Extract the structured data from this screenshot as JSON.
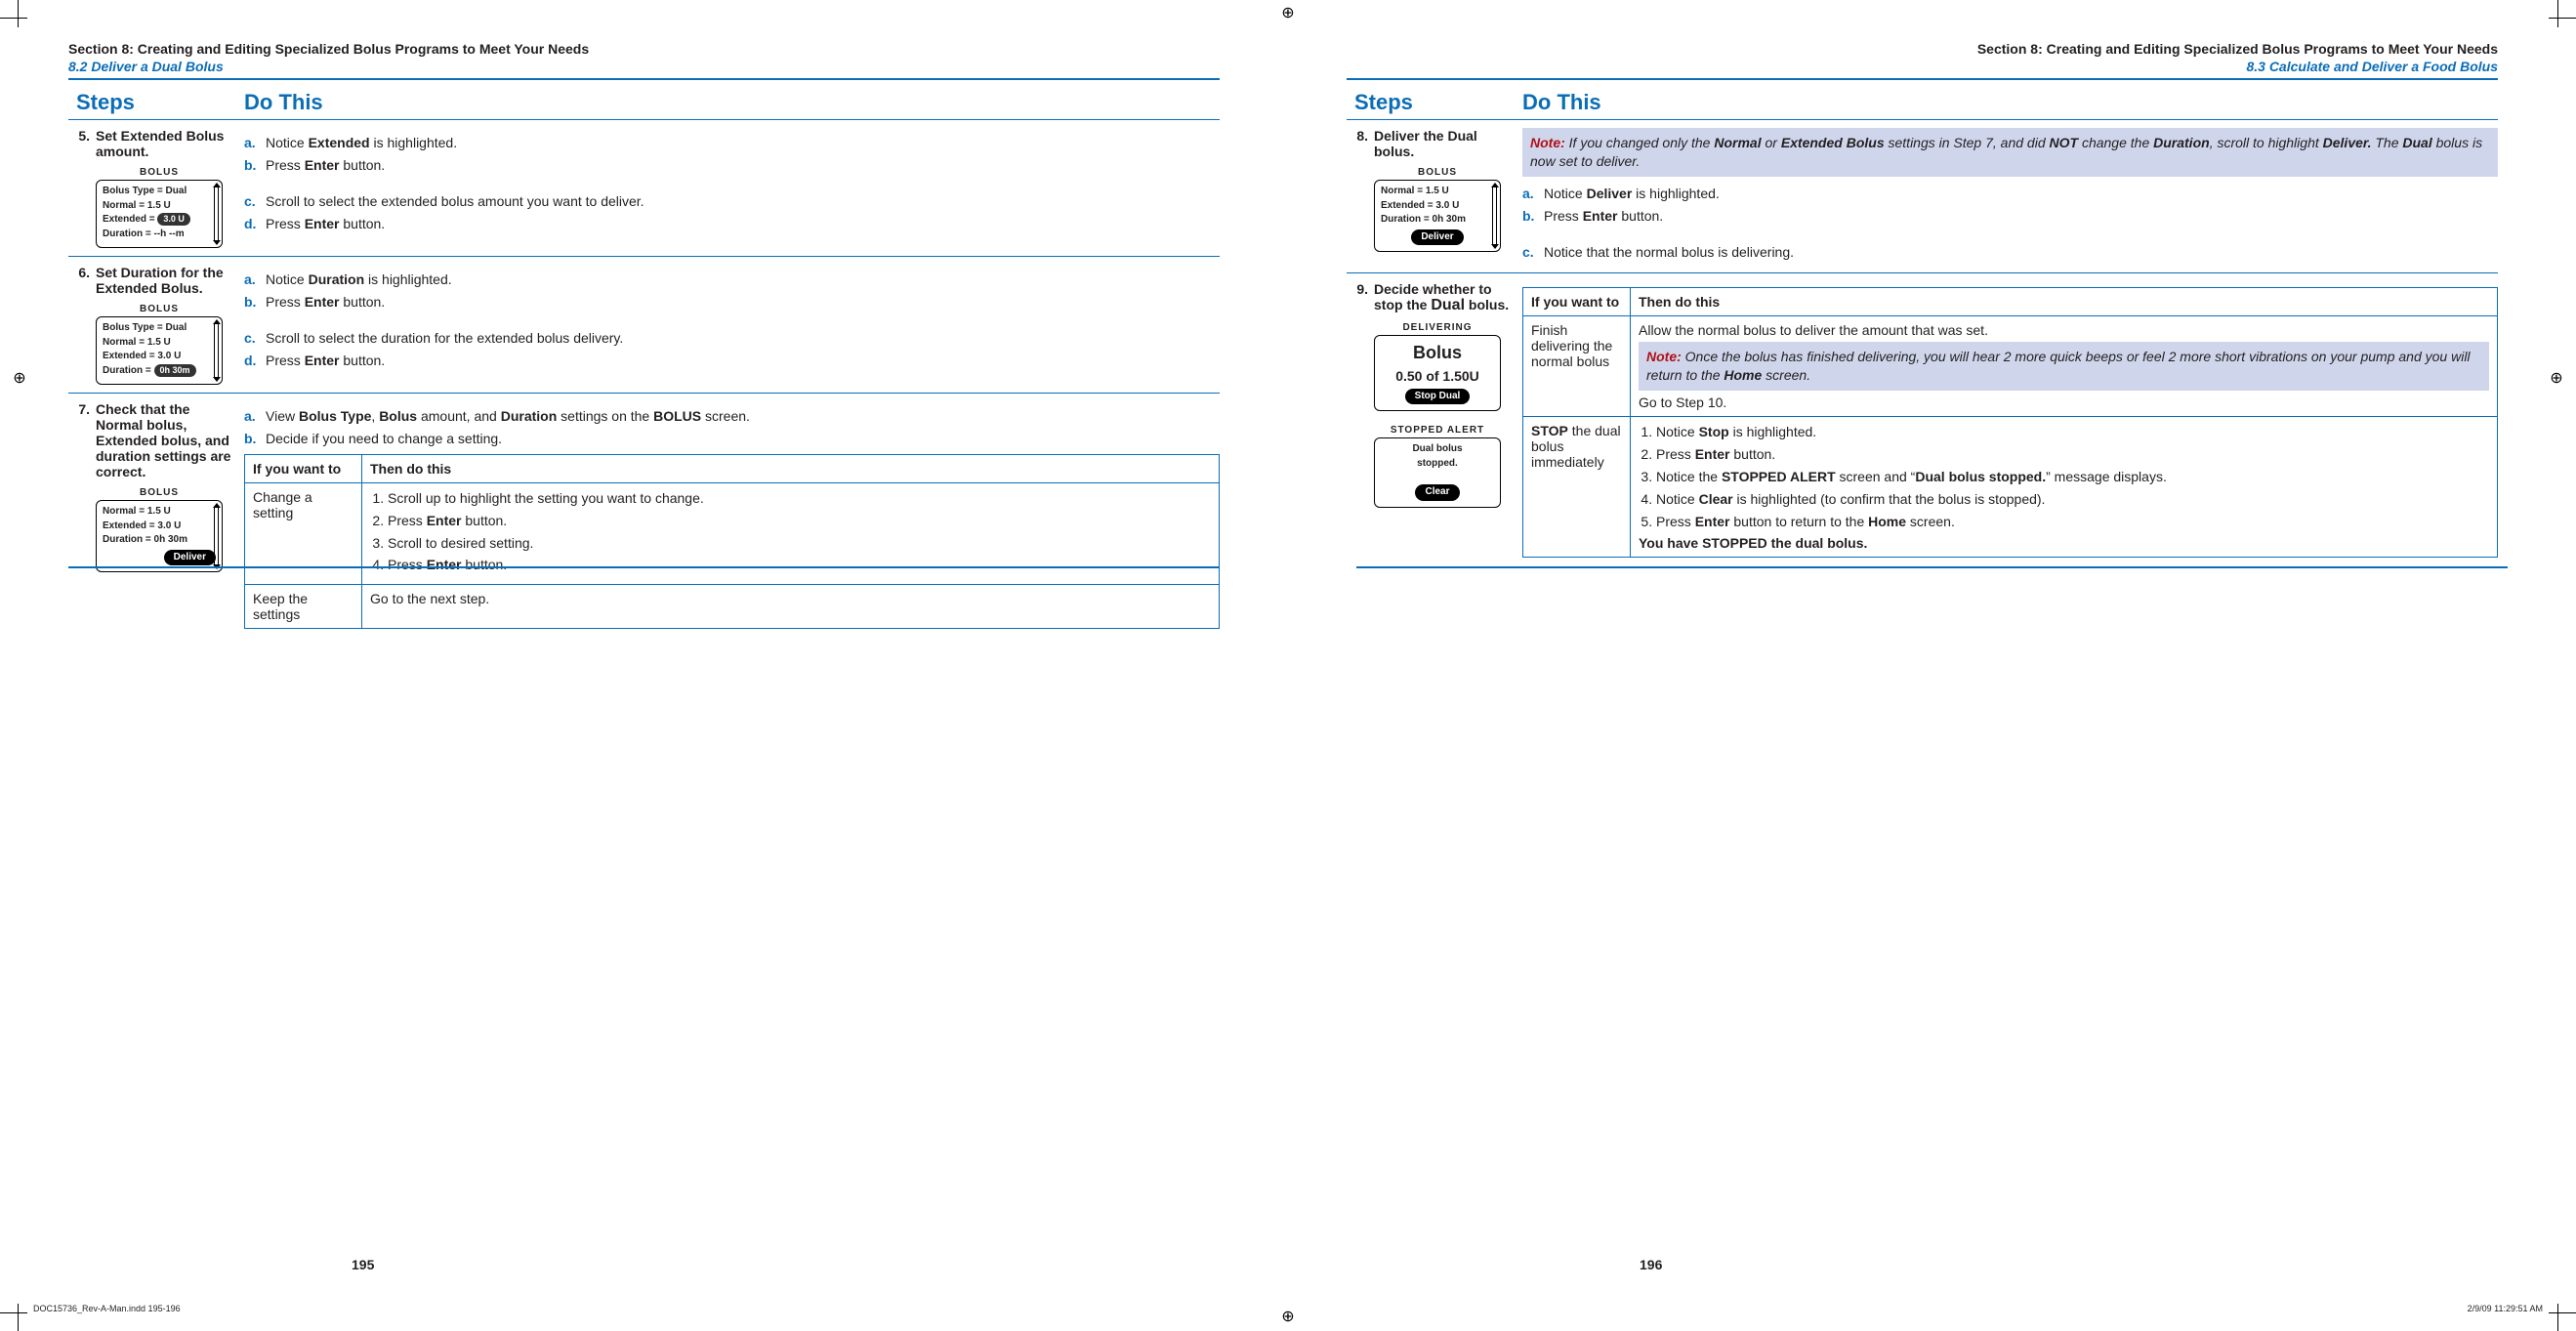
{
  "meta": {
    "indd": "DOC15736_Rev-A-Man.indd   195-196",
    "timestamp": "2/9/09   11:29:51 AM"
  },
  "left": {
    "section": "Section 8: Creating and Editing Specialized Bolus Programs to Meet Your Needs",
    "subsection": "8.2 Deliver a Dual Bolus",
    "col_steps": "Steps",
    "col_do": "Do This",
    "page_num": "195",
    "steps": {
      "s5": {
        "num": "5.",
        "label": "Set Extended Bolus amount.",
        "a": "Notice <b>Extended</b> is highlighted.",
        "b": "Press <b>Enter</b> button.",
        "c": "Scroll to select the extended bolus amount you want to deliver.",
        "d": "Press <b>Enter</b> button.",
        "device": {
          "title": "BOLUS",
          "l1": "Bolus Type = Dual",
          "l2": "Normal = 1.5 U",
          "l3_pre": "Extended =",
          "l3_hl": "3.0 U",
          "l4": "Duration = --h --m"
        }
      },
      "s6": {
        "num": "6.",
        "label": "Set Duration for the Extended Bolus.",
        "a": "Notice <b>Duration</b> is highlighted.",
        "b": "Press <b>Enter</b> button.",
        "c": "Scroll to select the duration for the extended bolus delivery.",
        "d": "Press <b>Enter</b> button.",
        "device": {
          "title": "BOLUS",
          "l1": "Bolus Type = Dual",
          "l2": "Normal = 1.5 U",
          "l3": "Extended = 3.0 U",
          "l4_pre": "Duration =",
          "l4_hl": "0h 30m"
        }
      },
      "s7": {
        "num": "7.",
        "label": "Check that the Normal bolus, Extended bolus, and duration settings are correct.",
        "a": "View <b>Bolus Type</b>, <b>Bolus</b> amount, and <b>Duration</b> settings on the <b>BOLUS</b> screen.",
        "b": "Decide if you need to change a setting.",
        "table": {
          "h1": "If you want to",
          "h2": "Then do this",
          "r1c1": "Change a setting",
          "r1_li1": "Scroll up to highlight the setting you want to change.",
          "r1_li2": "Press <b>Enter</b> button.",
          "r1_li3": "Scroll to desired setting.",
          "r1_li4": "Press <b>Enter</b> button.",
          "r2c1": "Keep the settings",
          "r2c2": "Go to the next step."
        },
        "device": {
          "title": "BOLUS",
          "l1": "Normal = 1.5 U",
          "l2": "Extended = 3.0 U",
          "l3": "Duration = 0h 30m",
          "btn": "Deliver"
        }
      }
    }
  },
  "right": {
    "section": "Section 8: Creating and Editing Specialized Bolus Programs to Meet Your Needs",
    "subsection": "8.3 Calculate and Deliver a Food Bolus",
    "col_steps": "Steps",
    "col_do": "Do This",
    "page_num": "196",
    "steps": {
      "s8": {
        "num": "8.",
        "label": "Deliver the Dual bolus.",
        "note": "If you changed only the <b>Normal</b> or <b>Extended Bolus</b> settings in Step 7, and did <b>NOT</b> change the <b>Duration</b>, scroll to highlight <b>Deliver.</b> The <b>Dual</b> bolus is now set to deliver.",
        "note_label": "Note:",
        "a": "Notice <b>Deliver</b> is highlighted.",
        "b": "Press <b>Enter</b> button.",
        "c": "Notice that the normal bolus is delivering.",
        "device": {
          "title": "BOLUS",
          "l1": "Normal = 1.5 U",
          "l2": "Extended = 3.0 U",
          "l3": "Duration = 0h 30m",
          "btn": "Deliver"
        }
      },
      "s9": {
        "num": "9.",
        "label_html": "Decide whether to stop the <b style='font-size:16px'>Dual</b> bolus.",
        "device1": {
          "title": "DELIVERING",
          "big1": "Bolus",
          "big2": "0.50 of 1.50U",
          "btn": "Stop Dual"
        },
        "device2": {
          "title": "STOPPED ALERT",
          "l1": "Dual bolus",
          "l2": "stopped.",
          "btn": "Clear"
        },
        "table": {
          "h1": "If you want to",
          "h2": "Then do this",
          "r1c1": "Finish delivering the normal bolus",
          "r1_top": "Allow the normal bolus to deliver the amount that was set.",
          "r1_note_label": "Note:",
          "r1_note": "Once the bolus has finished delivering, you will hear 2 more quick beeps or feel 2 more short vibrations on your pump and you will return to the <b>Home</b> screen.",
          "r1_bottom": "Go to Step 10.",
          "r2c1": "<b>STOP</b> the dual bolus immediately",
          "r2_li1": "Notice <b>Stop</b> is highlighted.",
          "r2_li2": "Press <b>Enter</b> button.",
          "r2_li3": "Notice the <b>STOPPED ALERT</b> screen and “<b>Dual bolus stopped.</b>” message displays.",
          "r2_li4": "Notice <b>Clear</b> is highlighted (to confirm that the bolus is stopped).",
          "r2_li5": "Press <b>Enter</b> button to return to the <b>Home</b> screen.",
          "r2_final": "You have STOPPED the dual bolus."
        }
      }
    }
  }
}
